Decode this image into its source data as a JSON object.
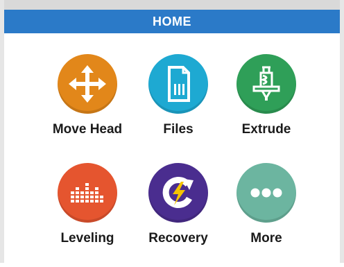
{
  "header": {
    "title": "HOME"
  },
  "tiles": [
    {
      "label": "Move Head",
      "icon": "move-arrows-icon",
      "color": "#e2871a"
    },
    {
      "label": "Files",
      "icon": "file-icon",
      "color": "#1ea9d2"
    },
    {
      "label": "Extrude",
      "icon": "extruder-icon",
      "color": "#2f9f58"
    },
    {
      "label": "Leveling",
      "icon": "leveling-bars-icon",
      "color": "#e5552f"
    },
    {
      "label": "Recovery",
      "icon": "recovery-bolt-icon",
      "color": "#4a2d8f"
    },
    {
      "label": "More",
      "icon": "more-dots-icon",
      "color": "#6cb5a0"
    }
  ],
  "colors": {
    "title_bar": "#2b7ac8"
  }
}
